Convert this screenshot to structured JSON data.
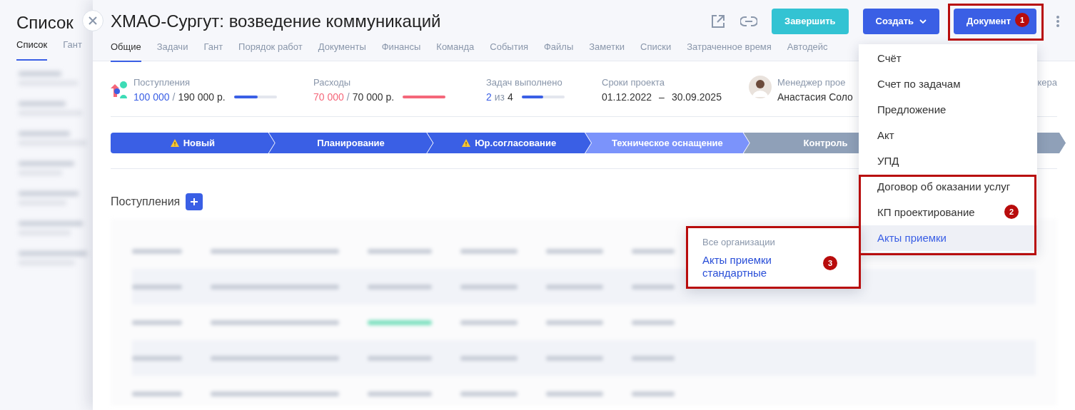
{
  "background_page": {
    "title": "Список",
    "tabs": [
      {
        "label": "Список",
        "selected": true
      },
      {
        "label": "Гант",
        "selected": false
      }
    ]
  },
  "panel": {
    "title": "ХМАО-Сургут: возведение коммуникаций",
    "actions": [
      {
        "kind": "finish",
        "label": "Завершить"
      },
      {
        "kind": "dropdown",
        "label": "Создать"
      },
      {
        "kind": "primary",
        "label": "Документ"
      }
    ],
    "tabs": [
      {
        "label": "Общие",
        "selected": true
      },
      {
        "label": "Задачи",
        "selected": false
      },
      {
        "label": "Гант",
        "selected": false
      },
      {
        "label": "Порядок работ",
        "selected": false
      },
      {
        "label": "Документы",
        "selected": false
      },
      {
        "label": "Финансы",
        "selected": false
      },
      {
        "label": "Команда",
        "selected": false
      },
      {
        "label": "События",
        "selected": false
      },
      {
        "label": "Файлы",
        "selected": false
      },
      {
        "label": "Заметки",
        "selected": false
      },
      {
        "label": "Списки",
        "selected": false
      },
      {
        "label": "Затраченное время",
        "selected": false
      },
      {
        "label": "Автодейс",
        "selected": false
      }
    ],
    "stats": [
      {
        "kind": "progress",
        "label": "Поступления",
        "value": "100 000",
        "separator": "/",
        "total": "190 000 р.",
        "level": 0.55,
        "color": "#3a5fe5"
      },
      {
        "kind": "progress",
        "label": "Расходы",
        "value": "70 000",
        "separator": "/",
        "total": "70 000 р.",
        "level": 1,
        "color": "#f5677a"
      },
      {
        "kind": "progress",
        "label": "Задач выполнено",
        "value": "2",
        "separator": "из",
        "total": "4",
        "level": 0.5,
        "color": "#3a5fe5"
      },
      {
        "kind": "dates",
        "label": "Сроки проекта",
        "start": "01.12.2022",
        "separator": "–",
        "end": "30.09.2025"
      },
      {
        "kind": "person",
        "label": "Менеджер прое",
        "value": "Анастасия Соло"
      },
      {
        "kind": "label",
        "label": "кера"
      }
    ],
    "stages": [
      {
        "label": "Новый",
        "kind": "done",
        "warning": true
      },
      {
        "label": "Планирование",
        "kind": "done",
        "warning": false
      },
      {
        "label": "Юр.согласование",
        "kind": "done",
        "warning": true
      },
      {
        "label": "Техническое оснащение",
        "kind": "current",
        "warning": false
      },
      {
        "label": "Контроль",
        "kind": "pending",
        "warning": false
      },
      {
        "kind": "pending"
      }
    ],
    "section": {
      "title": "Поступления"
    }
  },
  "menu": {
    "items": [
      {
        "label": "Счёт",
        "selected": false
      },
      {
        "label": "Счет по задачам",
        "selected": false
      },
      {
        "label": "Предложение",
        "selected": false
      },
      {
        "label": "Акт",
        "selected": false
      },
      {
        "label": "УПД",
        "selected": false
      },
      {
        "label": "Договор об оказании услуг",
        "selected": false
      },
      {
        "label": "КП проектирование",
        "selected": false
      },
      {
        "label": "Акты приемки",
        "selected": true
      }
    ]
  },
  "submenu": {
    "header": "Все организации",
    "items": [
      {
        "label": "Акты приемки стандартные"
      }
    ]
  },
  "annotations": [
    {
      "label": "1"
    },
    {
      "label": "2"
    },
    {
      "label": "3"
    }
  ]
}
